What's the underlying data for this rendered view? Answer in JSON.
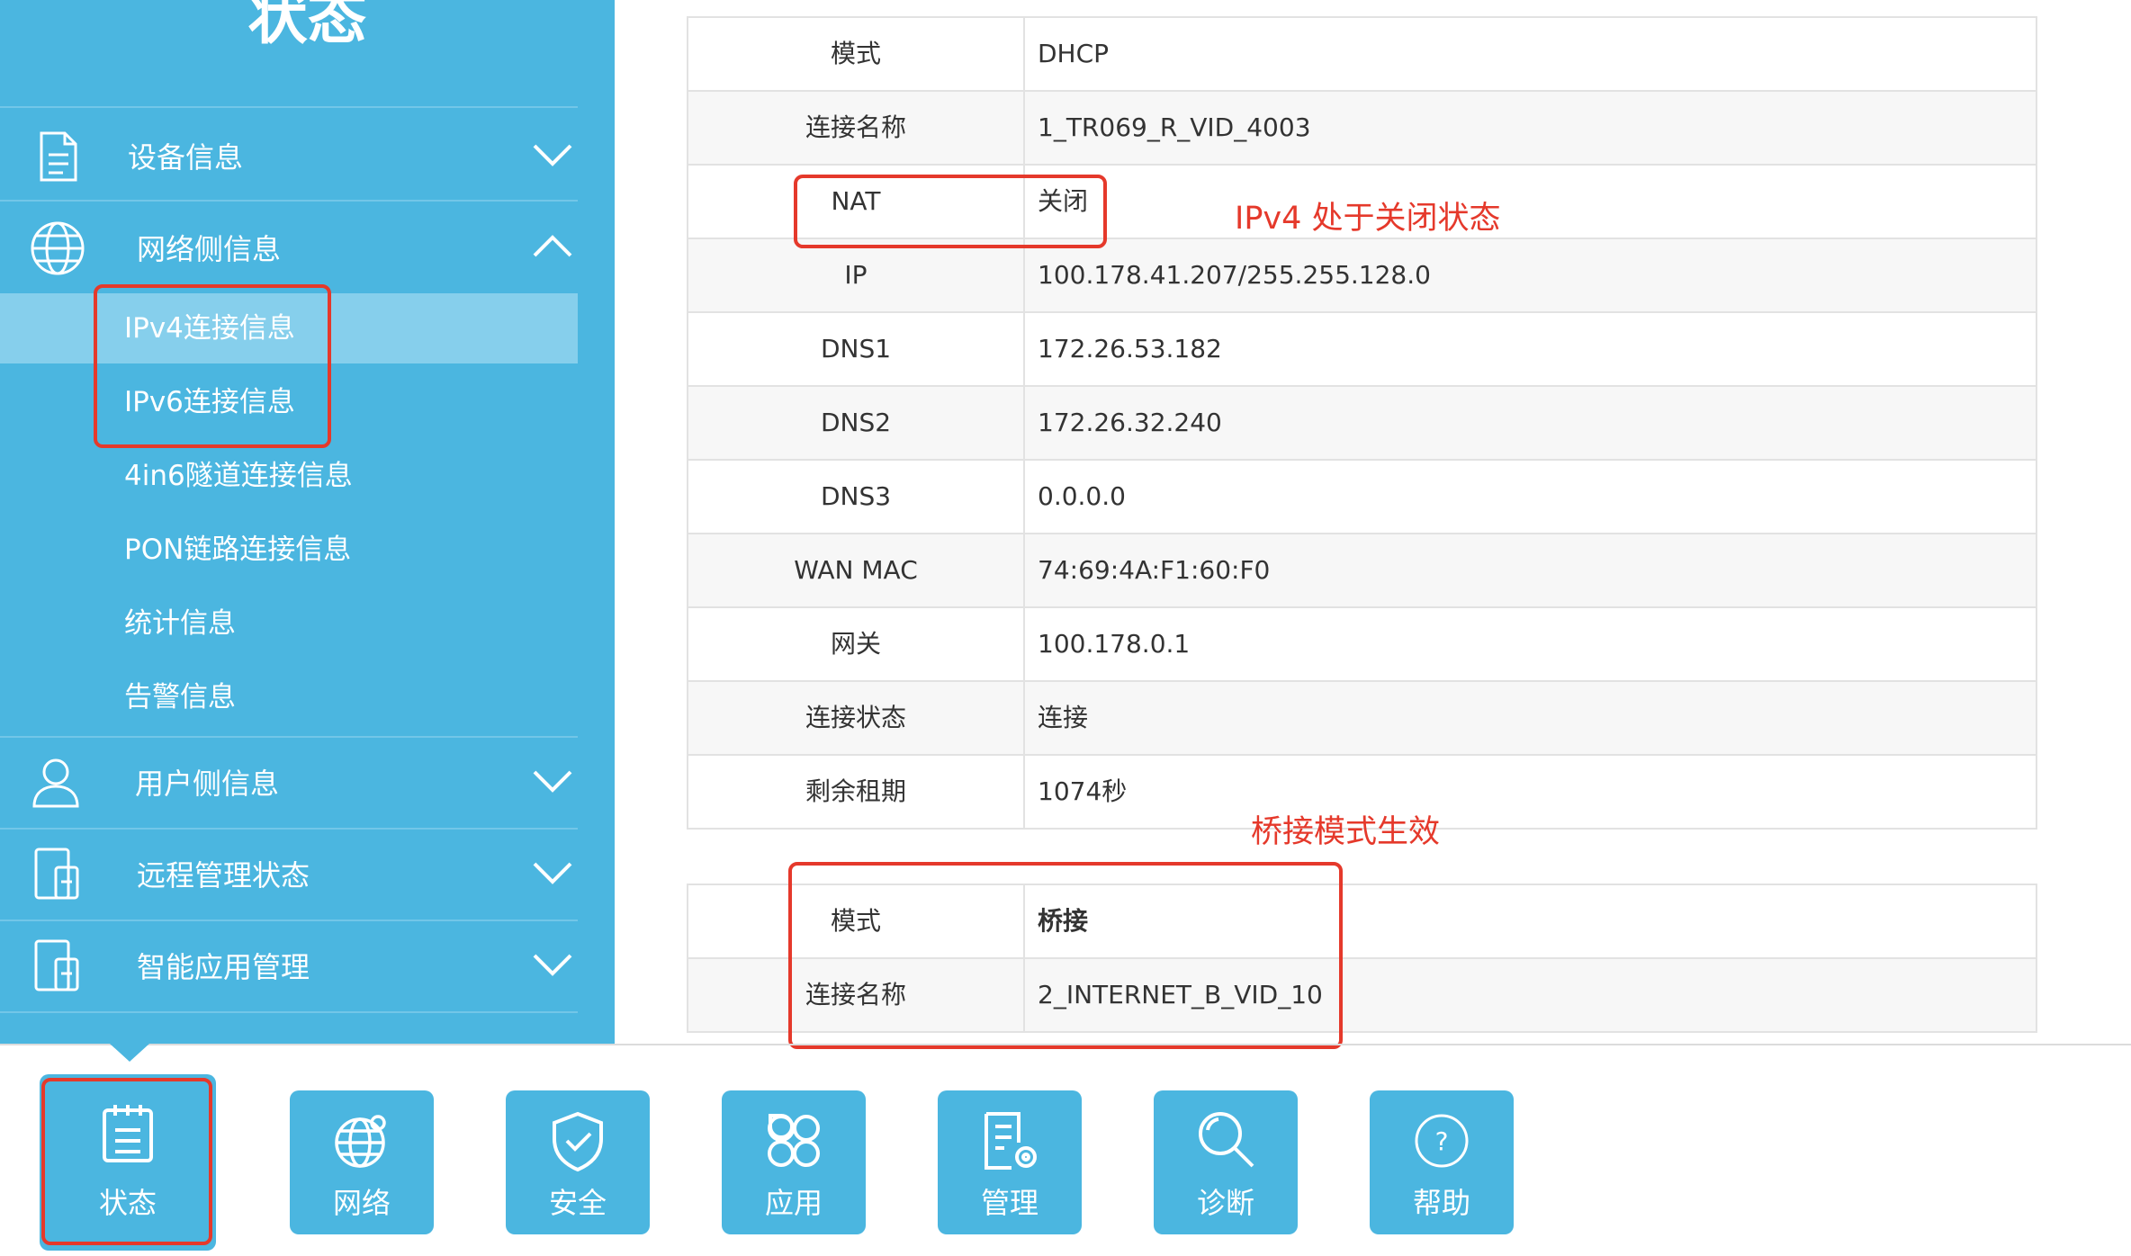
{
  "sidebar": {
    "title": "状态",
    "items": [
      {
        "label": "设备信息"
      },
      {
        "label": "网络侧信息"
      },
      {
        "label": "用户侧信息"
      },
      {
        "label": "远程管理状态"
      },
      {
        "label": "智能应用管理"
      }
    ],
    "subitems": [
      {
        "label": "IPv4连接信息"
      },
      {
        "label": "IPv6连接信息"
      },
      {
        "label": "4in6隧道连接信息"
      },
      {
        "label": "PON链路连接信息"
      },
      {
        "label": "统计信息"
      },
      {
        "label": "告警信息"
      }
    ]
  },
  "table1": {
    "rows": [
      {
        "key": "模式",
        "value": "DHCP"
      },
      {
        "key": "连接名称",
        "value": "1_TR069_R_VID_4003"
      },
      {
        "key": "NAT",
        "value": "关闭"
      },
      {
        "key": "IP",
        "value": "100.178.41.207/255.255.128.0"
      },
      {
        "key": "DNS1",
        "value": "172.26.53.182"
      },
      {
        "key": "DNS2",
        "value": "172.26.32.240"
      },
      {
        "key": "DNS3",
        "value": "0.0.0.0"
      },
      {
        "key": "WAN MAC",
        "value": "74:69:4A:F1:60:F0"
      },
      {
        "key": "网关",
        "value": "100.178.0.1"
      },
      {
        "key": "连接状态",
        "value": "连接"
      },
      {
        "key": "剩余租期",
        "value": "1074秒"
      }
    ]
  },
  "table2": {
    "rows": [
      {
        "key": "模式",
        "value": "桥接"
      },
      {
        "key": "连接名称",
        "value": "2_INTERNET_B_VID_10"
      }
    ]
  },
  "annotations": {
    "nat_note": "IPv4 处于关闭状态",
    "bridge_note": "桥接模式生效"
  },
  "bottom_nav": [
    {
      "label": "状态",
      "icon": "clipboard-icon"
    },
    {
      "label": "网络",
      "icon": "globe-icon"
    },
    {
      "label": "安全",
      "icon": "shield-check-icon"
    },
    {
      "label": "应用",
      "icon": "apps-icon"
    },
    {
      "label": "管理",
      "icon": "manage-icon"
    },
    {
      "label": "诊断",
      "icon": "search-icon"
    },
    {
      "label": "帮助",
      "icon": "help-icon"
    }
  ],
  "colors": {
    "accent": "#4bb6e0",
    "annotation": "#e5392b",
    "active_sub": "#86cfec"
  }
}
